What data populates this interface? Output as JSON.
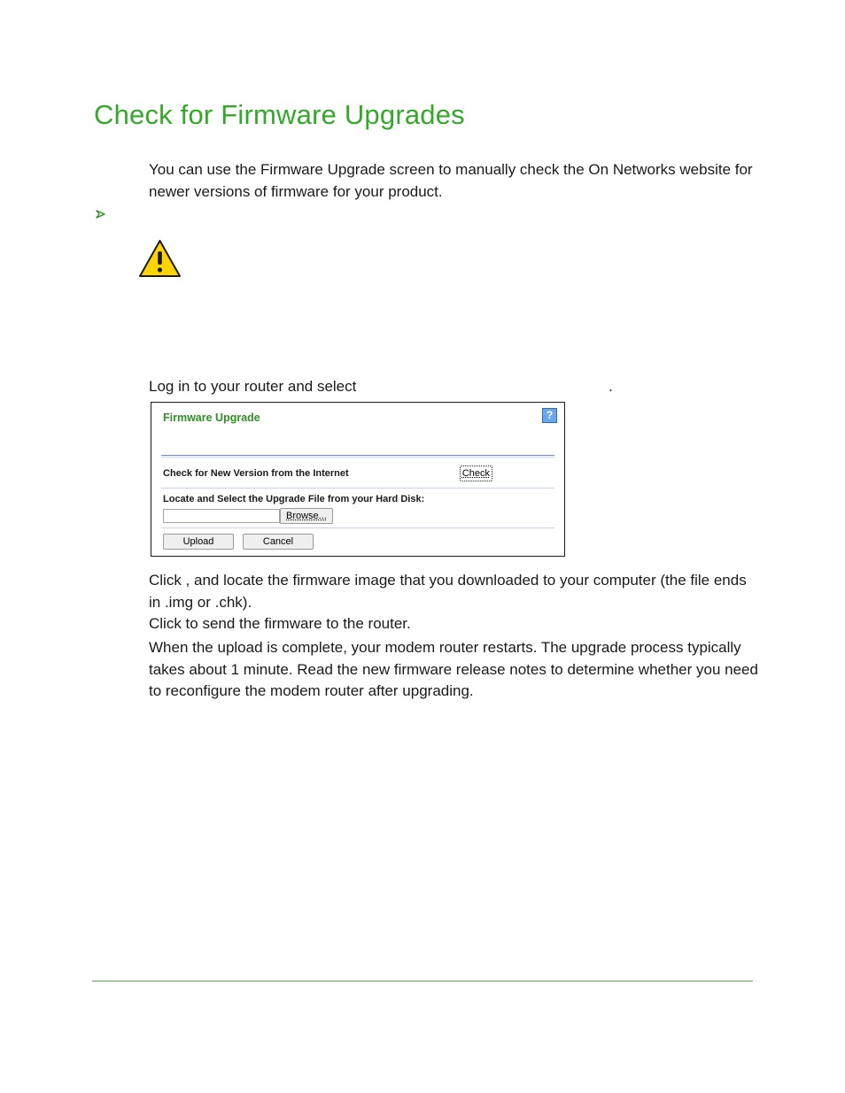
{
  "heading": "Check for Firmware Upgrades",
  "intro": "You can use the Firmware Upgrade screen to manually check the On Networks website for newer versions of firmware for your product.",
  "step1_pre": "Log in to your router and select ",
  "step1_post": ".",
  "panel": {
    "title": "Firmware Upgrade",
    "help": "?",
    "check_label": "Check for New Version from the Internet",
    "check_btn": "Check",
    "locate_label": "Locate and Select the Upgrade File from your Hard Disk:",
    "browse_btn": "Browse...",
    "upload_btn": "Upload",
    "cancel_btn": "Cancel"
  },
  "step2": "Click              , and locate the firmware image that you downloaded to your computer (the file ends in .img or .chk).",
  "step3": "Click              to send the firmware to the router.",
  "footnote": "When the upload is complete, your modem router restarts. The upgrade process typically takes about 1 minute. Read the new firmware release notes to determine whether you need to reconfigure the modem router after upgrading."
}
